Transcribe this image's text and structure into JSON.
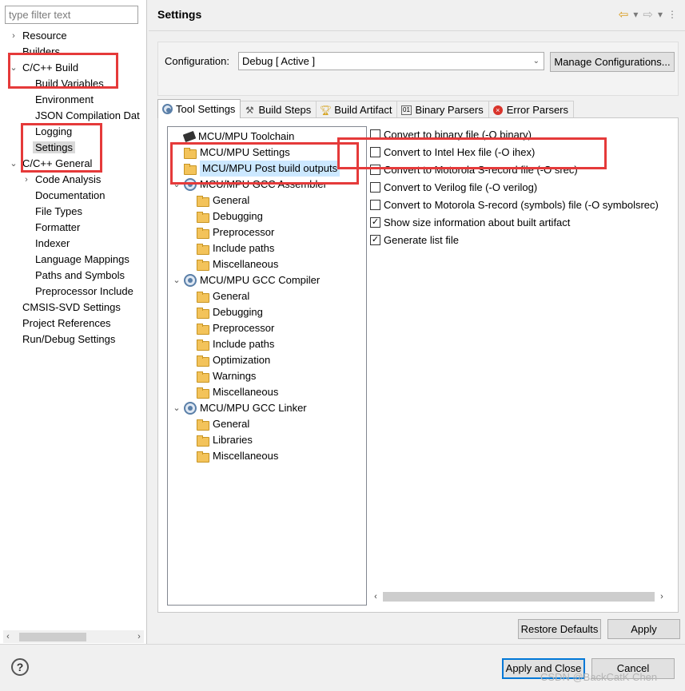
{
  "filter": {
    "placeholder": "type filter text"
  },
  "nav": [
    {
      "label": "Resource",
      "twisty": "›",
      "indent": 0
    },
    {
      "label": "Builders",
      "twisty": "",
      "indent": 0
    },
    {
      "label": "C/C++ Build",
      "twisty": "⌄",
      "indent": 0
    },
    {
      "label": "Build Variables",
      "twisty": "",
      "indent": 1
    },
    {
      "label": "Environment",
      "twisty": "",
      "indent": 1
    },
    {
      "label": "JSON Compilation Dat",
      "twisty": "",
      "indent": 1
    },
    {
      "label": "Logging",
      "twisty": "",
      "indent": 1
    },
    {
      "label": "Settings",
      "twisty": "",
      "indent": 1,
      "selected": true
    },
    {
      "label": "C/C++ General",
      "twisty": "⌄",
      "indent": 0
    },
    {
      "label": "Code Analysis",
      "twisty": "›",
      "indent": 1
    },
    {
      "label": "Documentation",
      "twisty": "",
      "indent": 1
    },
    {
      "label": "File Types",
      "twisty": "",
      "indent": 1
    },
    {
      "label": "Formatter",
      "twisty": "",
      "indent": 1
    },
    {
      "label": "Indexer",
      "twisty": "",
      "indent": 1
    },
    {
      "label": "Language Mappings",
      "twisty": "",
      "indent": 1
    },
    {
      "label": "Paths and Symbols",
      "twisty": "",
      "indent": 1
    },
    {
      "label": "Preprocessor Include",
      "twisty": "",
      "indent": 1
    },
    {
      "label": "CMSIS-SVD Settings",
      "twisty": "",
      "indent": 0
    },
    {
      "label": "Project References",
      "twisty": "",
      "indent": 0
    },
    {
      "label": "Run/Debug Settings",
      "twisty": "",
      "indent": 0
    }
  ],
  "header": {
    "title": "Settings"
  },
  "config": {
    "label": "Configuration:",
    "value": "Debug  [ Active ]",
    "manage_label": "Manage Configurations..."
  },
  "tabs": [
    {
      "label": "Tool Settings",
      "icon": "gear-icon",
      "active": true
    },
    {
      "label": "Build Steps",
      "icon": "hammer-icon"
    },
    {
      "label": "Build Artifact",
      "icon": "trophy-icon"
    },
    {
      "label": "Binary Parsers",
      "icon": "binary-file-icon"
    },
    {
      "label": "Error Parsers",
      "icon": "error-icon"
    }
  ],
  "tool_tree": [
    {
      "label": "MCU/MPU Toolchain",
      "icon": "chip",
      "level": 1,
      "twisty": ""
    },
    {
      "label": "MCU/MPU Settings",
      "icon": "folder",
      "level": 1,
      "twisty": ""
    },
    {
      "label": "MCU/MPU Post build outputs",
      "icon": "folder",
      "level": 1,
      "twisty": "",
      "selected": true
    },
    {
      "label": "MCU/MPU GCC Assembler",
      "icon": "gear",
      "level": 1,
      "twisty": "⌄"
    },
    {
      "label": "General",
      "icon": "folder",
      "level": 2,
      "twisty": ""
    },
    {
      "label": "Debugging",
      "icon": "folder",
      "level": 2,
      "twisty": ""
    },
    {
      "label": "Preprocessor",
      "icon": "folder",
      "level": 2,
      "twisty": ""
    },
    {
      "label": "Include paths",
      "icon": "folder",
      "level": 2,
      "twisty": ""
    },
    {
      "label": "Miscellaneous",
      "icon": "folder",
      "level": 2,
      "twisty": ""
    },
    {
      "label": "MCU/MPU GCC Compiler",
      "icon": "gear",
      "level": 1,
      "twisty": "⌄"
    },
    {
      "label": "General",
      "icon": "folder",
      "level": 2,
      "twisty": ""
    },
    {
      "label": "Debugging",
      "icon": "folder",
      "level": 2,
      "twisty": ""
    },
    {
      "label": "Preprocessor",
      "icon": "folder",
      "level": 2,
      "twisty": ""
    },
    {
      "label": "Include paths",
      "icon": "folder",
      "level": 2,
      "twisty": ""
    },
    {
      "label": "Optimization",
      "icon": "folder",
      "level": 2,
      "twisty": ""
    },
    {
      "label": "Warnings",
      "icon": "folder",
      "level": 2,
      "twisty": ""
    },
    {
      "label": "Miscellaneous",
      "icon": "folder",
      "level": 2,
      "twisty": ""
    },
    {
      "label": "MCU/MPU GCC Linker",
      "icon": "gear",
      "level": 1,
      "twisty": "⌄"
    },
    {
      "label": "General",
      "icon": "folder",
      "level": 2,
      "twisty": ""
    },
    {
      "label": "Libraries",
      "icon": "folder",
      "level": 2,
      "twisty": ""
    },
    {
      "label": "Miscellaneous",
      "icon": "folder",
      "level": 2,
      "twisty": ""
    }
  ],
  "options": [
    {
      "label": "Convert to binary file (-O binary)",
      "checked": false
    },
    {
      "label": "Convert to Intel Hex file (-O ihex)",
      "checked": false
    },
    {
      "label": "Convert to Motorola S-record file (-O srec)",
      "checked": false
    },
    {
      "label": "Convert to Verilog file (-O verilog)",
      "checked": false
    },
    {
      "label": "Convert to Motorola S-record (symbols) file (-O symbolsrec)",
      "checked": false
    },
    {
      "label": "Show size information about built artifact",
      "checked": true
    },
    {
      "label": "Generate list file",
      "checked": true
    }
  ],
  "buttons": {
    "restore": "Restore Defaults",
    "apply": "Apply",
    "apply_close": "Apply and Close",
    "cancel": "Cancel",
    "help": "?"
  },
  "watermark": "CSDN @BackCatK Chen",
  "colors": {
    "highlight": "#e53a3a",
    "selection": "#cce8ff",
    "default_button_border": "#0078d7"
  }
}
